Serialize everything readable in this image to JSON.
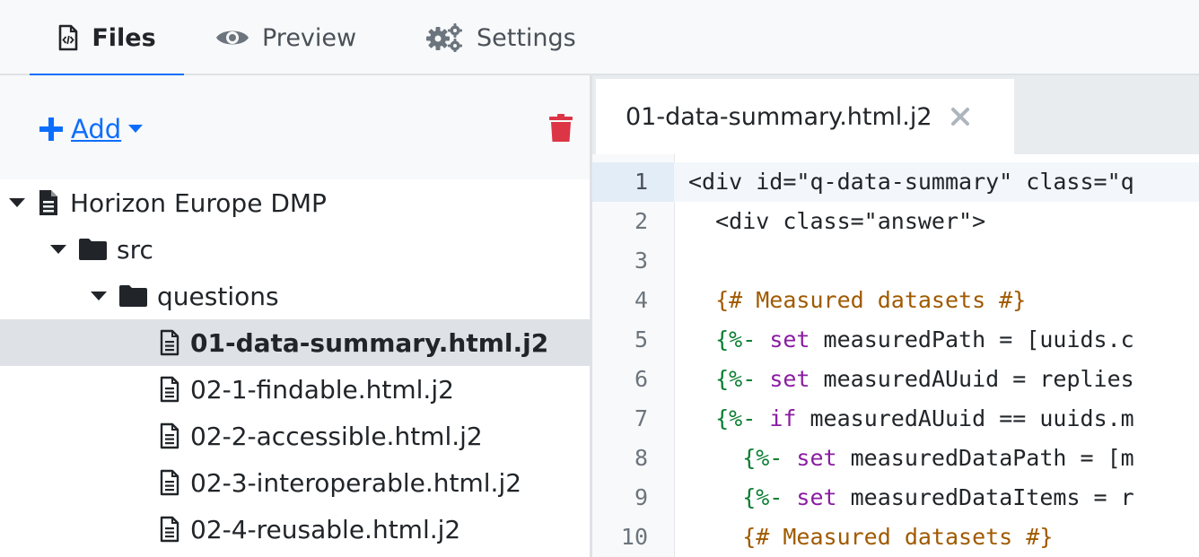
{
  "nav": {
    "tabs": [
      {
        "label": "Files",
        "icon": "file-code-icon",
        "active": true
      },
      {
        "label": "Preview",
        "icon": "eye-icon",
        "active": false
      },
      {
        "label": "Settings",
        "icon": "cogs-icon",
        "active": false
      }
    ]
  },
  "toolbar": {
    "add_label": "Add",
    "add_icon": "plus-icon",
    "delete_icon": "trash-icon"
  },
  "tree": {
    "items": [
      {
        "label": "Horizon Europe DMP",
        "type": "document",
        "depth": 0,
        "expanded": true
      },
      {
        "label": "src",
        "type": "folder",
        "depth": 1,
        "expanded": true
      },
      {
        "label": "questions",
        "type": "folder",
        "depth": 2,
        "expanded": true
      },
      {
        "label": "01-data-summary.html.j2",
        "type": "file",
        "depth": 3,
        "selected": true
      },
      {
        "label": "02-1-findable.html.j2",
        "type": "file",
        "depth": 3
      },
      {
        "label": "02-2-accessible.html.j2",
        "type": "file",
        "depth": 3
      },
      {
        "label": "02-3-interoperable.html.j2",
        "type": "file",
        "depth": 3
      },
      {
        "label": "02-4-reusable.html.j2",
        "type": "file",
        "depth": 3
      }
    ]
  },
  "editor": {
    "open_tab": "01-data-summary.html.j2",
    "lines": [
      {
        "n": "1",
        "tokens": [
          [
            "text",
            "<div id=\"q-data-summary\" class=\"q"
          ]
        ]
      },
      {
        "n": "2",
        "tokens": [
          [
            "text",
            "  <div class=\"answer\">"
          ]
        ]
      },
      {
        "n": "3",
        "tokens": []
      },
      {
        "n": "4",
        "tokens": [
          [
            "comment",
            "  {# Measured datasets #}"
          ]
        ]
      },
      {
        "n": "5",
        "tokens": [
          [
            "delim",
            "  {%-"
          ],
          [
            "text",
            " "
          ],
          [
            "kw",
            "set"
          ],
          [
            "text",
            " measuredPath = [uuids.c"
          ]
        ]
      },
      {
        "n": "6",
        "tokens": [
          [
            "delim",
            "  {%-"
          ],
          [
            "text",
            " "
          ],
          [
            "kw",
            "set"
          ],
          [
            "text",
            " measuredAUuid = replies"
          ]
        ]
      },
      {
        "n": "7",
        "tokens": [
          [
            "delim",
            "  {%-"
          ],
          [
            "text",
            " "
          ],
          [
            "kw",
            "if"
          ],
          [
            "text",
            " measuredAUuid == uuids.m"
          ]
        ]
      },
      {
        "n": "8",
        "tokens": [
          [
            "delim",
            "    {%-"
          ],
          [
            "text",
            " "
          ],
          [
            "kw",
            "set"
          ],
          [
            "text",
            " measuredDataPath = [m"
          ]
        ]
      },
      {
        "n": "9",
        "tokens": [
          [
            "delim",
            "    {%-"
          ],
          [
            "text",
            " "
          ],
          [
            "kw",
            "set"
          ],
          [
            "text",
            " measuredDataItems = r"
          ]
        ]
      },
      {
        "n": "10",
        "tokens": [
          [
            "comment",
            "    {# Measured datasets #}"
          ]
        ]
      }
    ]
  },
  "colors": {
    "accent": "#0d6efd",
    "danger": "#dc3545",
    "comment": "#a05a00",
    "delimiter": "#0a7e32",
    "keyword": "#8a1da1"
  }
}
